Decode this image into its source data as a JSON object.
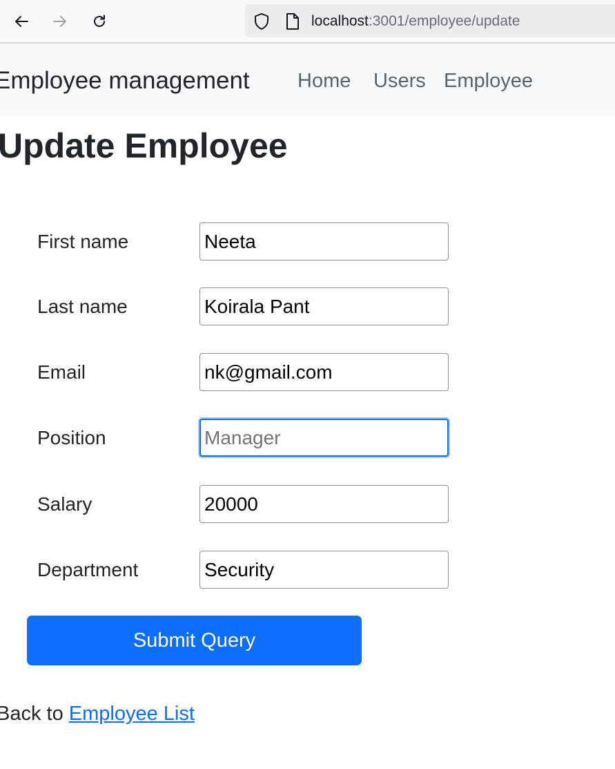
{
  "browser": {
    "url_host": "localhost",
    "url_path": ":3001/employee/update",
    "icons": [
      "back-arrow-icon",
      "forward-arrow-icon",
      "reload-icon",
      "shield-icon",
      "page-icon"
    ]
  },
  "navbar": {
    "brand": "Employee management",
    "links": [
      "Home",
      "Users",
      "Employee"
    ]
  },
  "page": {
    "title": "Update Employee"
  },
  "form": {
    "fields": [
      {
        "label": "First name",
        "value": "Neeta",
        "placeholder": ""
      },
      {
        "label": "Last name",
        "value": "Koirala Pant",
        "placeholder": ""
      },
      {
        "label": "Email",
        "value": "nk@gmail.com",
        "placeholder": ""
      },
      {
        "label": "Position",
        "value": "",
        "placeholder": "Manager"
      },
      {
        "label": "Salary",
        "value": "20000",
        "placeholder": ""
      },
      {
        "label": "Department",
        "value": "Security",
        "placeholder": ""
      }
    ],
    "submit_label": "Submit Query"
  },
  "footer": {
    "back_prefix": "Back to ",
    "back_link": "Employee List"
  },
  "colors": {
    "primary": "#0d6efd",
    "navbar_bg": "#f8f9fa",
    "text": "#212529",
    "nav_link": "#5c636a"
  }
}
